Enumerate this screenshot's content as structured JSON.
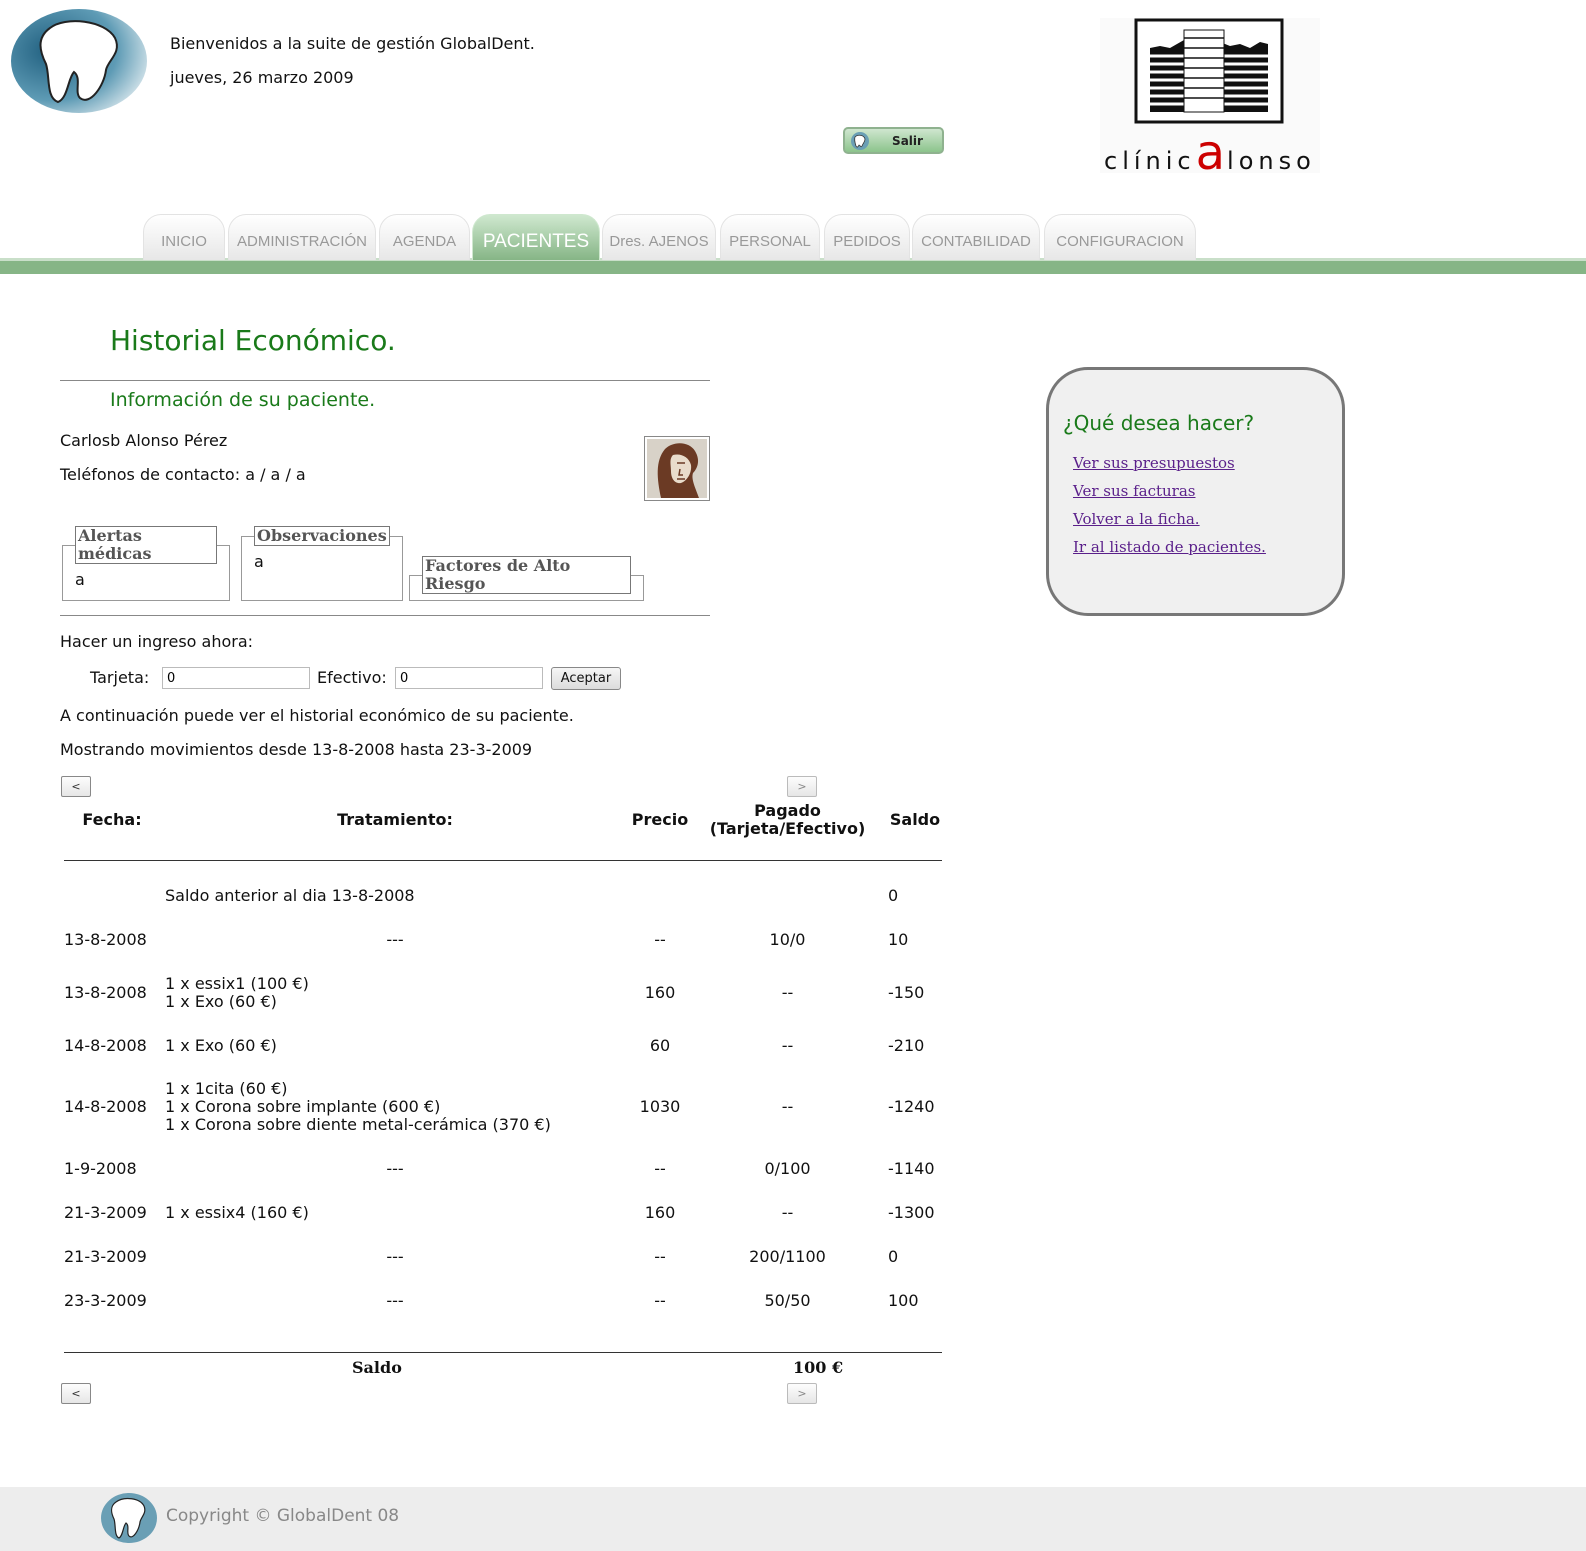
{
  "header": {
    "welcome": "Bienvenidos a la suite de gestión GlobalDent.",
    "date": "jueves, 26 marzo 2009",
    "logout_label": "Salir",
    "clinic_name_part1": "clínic",
    "clinic_name_big": "a",
    "clinic_name_part2": "lonso"
  },
  "nav": {
    "tabs": [
      {
        "label": "INICIO"
      },
      {
        "label": "ADMINISTRACIÓN"
      },
      {
        "label": "AGENDA"
      },
      {
        "label": "PACIENTES"
      },
      {
        "label": "Dres. AJENOS"
      },
      {
        "label": "PERSONAL"
      },
      {
        "label": "PEDIDOS"
      },
      {
        "label": "CONTABILIDAD"
      },
      {
        "label": "CONFIGURACION"
      }
    ],
    "active": "PACIENTES"
  },
  "page": {
    "title": "Historial Económico.",
    "subtitle": "Información de su paciente."
  },
  "patient": {
    "name": "Carlosb Alonso Pérez",
    "phones": "Teléfonos de contacto: a / a / a"
  },
  "boxes": {
    "alertas_label": "Alertas médicas",
    "alertas_value": "a",
    "observaciones_label": "Observaciones",
    "observaciones_value": "a",
    "factores_label": "Factores de Alto Riesgo"
  },
  "payment": {
    "prompt": "Hacer un ingreso ahora:",
    "tarjeta_label": "Tarjeta:",
    "tarjeta_value": "0",
    "efectivo_label": "Efectivo:",
    "efectivo_value": "0",
    "submit_label": "Aceptar"
  },
  "history": {
    "intro": "A continuación puede ver el historial económico de su paciente.",
    "range": "Mostrando movimientos desde 13-8-2008 hasta 23-3-2009",
    "prev_label": "<",
    "next_label": ">",
    "columns": {
      "fecha": "Fecha:",
      "tratamiento": "Tratamiento:",
      "precio": "Precio",
      "pagado_1": "Pagado",
      "pagado_2": "(Tarjeta/Efectivo)",
      "saldo": "Saldo"
    },
    "previous_balance": {
      "label": "Saldo anterior al dia 13-8-2008",
      "saldo": "0"
    },
    "rows": [
      {
        "fecha": "13-8-2008",
        "tratamiento": [
          "---"
        ],
        "precio": "--",
        "pagado": "10/0",
        "saldo": "10"
      },
      {
        "fecha": "13-8-2008",
        "tratamiento": [
          "1 x essix1 (100 €)",
          "1 x Exo (60 €)"
        ],
        "precio": "160",
        "pagado": "--",
        "saldo": "-150"
      },
      {
        "fecha": "14-8-2008",
        "tratamiento": [
          "1 x Exo (60 €)"
        ],
        "precio": "60",
        "pagado": "--",
        "saldo": "-210"
      },
      {
        "fecha": "14-8-2008",
        "tratamiento": [
          "1 x 1cita (60 €)",
          "1 x Corona sobre implante (600 €)",
          "1 x Corona sobre diente metal-cerámica (370 €)"
        ],
        "precio": "1030",
        "pagado": "--",
        "saldo": "-1240"
      },
      {
        "fecha": "1-9-2008",
        "tratamiento": [
          "---"
        ],
        "precio": "--",
        "pagado": "0/100",
        "saldo": "-1140"
      },
      {
        "fecha": "21-3-2009",
        "tratamiento": [
          "1 x essix4 (160 €)"
        ],
        "precio": "160",
        "pagado": "--",
        "saldo": "-1300"
      },
      {
        "fecha": "21-3-2009",
        "tratamiento": [
          "---"
        ],
        "precio": "--",
        "pagado": "200/1100",
        "saldo": "0"
      },
      {
        "fecha": "23-3-2009",
        "tratamiento": [
          "---"
        ],
        "precio": "--",
        "pagado": "50/50",
        "saldo": "100"
      }
    ],
    "total_label": "Saldo",
    "total_value": "100 €"
  },
  "actions": {
    "title": "¿Qué desea hacer?",
    "links": [
      {
        "label": "Ver sus presupuestos"
      },
      {
        "label": "Ver sus facturas"
      },
      {
        "label": "Volver a la ficha."
      },
      {
        "label": "Ir al listado de pacientes."
      }
    ]
  },
  "footer": {
    "copyright": "Copyright © GlobalDent 08"
  },
  "colors": {
    "accent_green": "#1a7a1a",
    "nav_bar": "#86b586",
    "link_visited": "#5a1f8a"
  }
}
